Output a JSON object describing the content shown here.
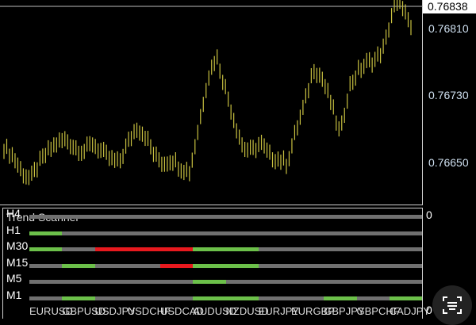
{
  "price_axis": {
    "current": "0.76838",
    "ticks": [
      "0.76810",
      "0.76730",
      "0.76650"
    ]
  },
  "chart_data": {
    "type": "bar",
    "series_color": "#c8c040",
    "prices": [
      0.7667,
      0.7666,
      0.76641,
      0.76632,
      0.76651,
      0.76665,
      0.76675,
      0.76679,
      0.7667,
      0.76665,
      0.76675,
      0.76665,
      0.76656,
      0.76651,
      0.76675,
      0.76694,
      0.76684,
      0.7666,
      0.76651,
      0.76656,
      0.76646,
      0.76641,
      0.76694,
      0.76751,
      0.76779,
      0.76741,
      0.76703,
      0.7667,
      0.76665,
      0.76675,
      0.7666,
      0.76656,
      0.76651,
      0.76689,
      0.76722,
      0.76765,
      0.76751,
      0.76722,
      0.76684,
      0.76741,
      0.7676,
      0.7677,
      0.76774,
      0.76789,
      0.76836,
      0.76841,
      0.76808
    ],
    "ylim": [
      0.76601,
      0.76845
    ]
  },
  "scanner": {
    "title": "Trend Scanner",
    "zero_top": "0",
    "zero_bottom": "0",
    "colors": {
      "up": "#6cc04a",
      "down": "#e8191e",
      "neutral": "#707070"
    },
    "symbols": [
      "EURUSD",
      "GBPUSD",
      "USDJPY",
      "USDCHF",
      "USDCAD",
      "AUDUSD",
      "NZDUSD",
      "EURJPY",
      "EURGBP",
      "GBPJPY",
      "GBPCHF",
      "CADJPY"
    ],
    "rows": [
      {
        "label": "H4",
        "states": [
          "n",
          "n",
          "n",
          "n",
          "n",
          "n",
          "n",
          "n",
          "n",
          "n",
          "n",
          "n"
        ]
      },
      {
        "label": "H1",
        "states": [
          "u",
          "n",
          "n",
          "n",
          "n",
          "n",
          "n",
          "n",
          "n",
          "n",
          "n",
          "n"
        ]
      },
      {
        "label": "M30",
        "states": [
          "u",
          "n",
          "d",
          "d",
          "d",
          "u",
          "u",
          "n",
          "n",
          "n",
          "n",
          "n"
        ]
      },
      {
        "label": "M15",
        "states": [
          "n",
          "u",
          "n",
          "n",
          "d",
          "u",
          "u",
          "n",
          "n",
          "n",
          "n",
          "n"
        ]
      },
      {
        "label": "M5",
        "states": [
          "n",
          "n",
          "n",
          "n",
          "n",
          "u",
          "n",
          "n",
          "n",
          "n",
          "n",
          "n"
        ]
      },
      {
        "label": "M1",
        "states": [
          "n",
          "u",
          "n",
          "n",
          "n",
          "u",
          "u",
          "n",
          "n",
          "u",
          "n",
          "u"
        ]
      }
    ]
  }
}
